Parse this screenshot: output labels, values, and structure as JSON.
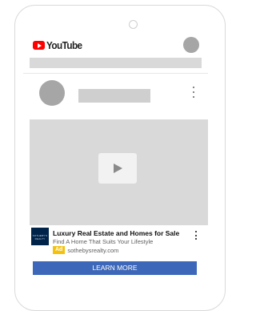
{
  "app": {
    "logo_text": "YouTube",
    "logo_icon": "youtube-play-icon",
    "brand_color": "#ff0000"
  },
  "ad": {
    "logo_text": "SOTHEBY'S REALTY",
    "title": "Luxury Real Estate and Homes for Sale",
    "description": "Find A Home That Suits Your Lifestyle",
    "badge": "Ad",
    "badge_color": "#f4c20d",
    "domain": "sothebysrealty.com",
    "cta_label": "LEARN MORE",
    "cta_color": "#3d67b8"
  }
}
